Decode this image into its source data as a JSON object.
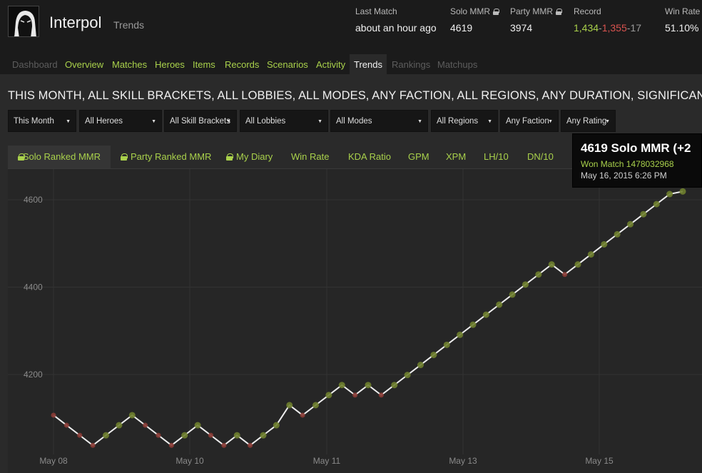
{
  "header": {
    "player_name": "Interpol",
    "page_subtitle": "Trends",
    "stats": {
      "last_match": {
        "label": "Last Match",
        "value": "about an hour ago"
      },
      "solo_mmr": {
        "label": "Solo MMR",
        "value": "4619"
      },
      "party_mmr": {
        "label": "Party MMR",
        "value": "3974"
      },
      "record": {
        "label": "Record",
        "wins": "1,434",
        "losses": "1,355",
        "abandons": "17",
        "separator": "-"
      },
      "win_rate": {
        "label": "Win Rate",
        "value": "51.10%"
      }
    }
  },
  "nav": [
    {
      "label": "Dashboard",
      "state": "disabled"
    },
    {
      "label": "Overview",
      "state": "enabled"
    },
    {
      "label": "Matches",
      "state": "enabled"
    },
    {
      "label": "Heroes",
      "state": "enabled"
    },
    {
      "label": "Items",
      "state": "enabled"
    },
    {
      "label": "Records",
      "state": "enabled"
    },
    {
      "label": "Scenarios",
      "state": "enabled"
    },
    {
      "label": "Activity",
      "state": "enabled"
    },
    {
      "label": "Trends",
      "state": "active"
    },
    {
      "label": "Rankings",
      "state": "disabled"
    },
    {
      "label": "Matchups",
      "state": "disabled"
    }
  ],
  "filter_title": "THIS MONTH, ALL SKILL BRACKETS, ALL LOBBIES, ALL MODES, ANY FACTION, ALL REGIONS, ANY DURATION, SIGNIFICANT",
  "filters": [
    "This Month",
    "All Heroes",
    "All Skill Brackets",
    "All Lobbies",
    "All Modes",
    "All Regions",
    "Any Faction",
    "Any Rating"
  ],
  "tabs": [
    {
      "label": "Solo Ranked MMR",
      "locked": true,
      "active": true
    },
    {
      "label": "Party Ranked MMR",
      "locked": true,
      "active": false
    },
    {
      "label": "My Diary",
      "locked": true,
      "active": false
    },
    {
      "label": "Win Rate",
      "locked": false,
      "active": false
    },
    {
      "label": "KDA Ratio",
      "locked": false,
      "active": false
    },
    {
      "label": "GPM",
      "locked": false,
      "active": false
    },
    {
      "label": "XPM",
      "locked": false,
      "active": false
    },
    {
      "label": "LH/10",
      "locked": false,
      "active": false
    },
    {
      "label": "DN/10",
      "locked": false,
      "active": false
    }
  ],
  "tooltip": {
    "title": "4619 Solo MMR (+2",
    "result": "Won Match 1478032968",
    "date": "May 16, 2015 6:26 PM"
  },
  "colors": {
    "win": "#a9d14b",
    "loss": "#d9534f",
    "line": "#eeeeee",
    "win_point": "#6f7f2f",
    "loss_point": "#8a3b35"
  },
  "chart_data": {
    "type": "line",
    "title": "",
    "xlabel": "",
    "ylabel": "",
    "ylim": [
      4030,
      4660
    ],
    "xlim": [
      "May 07 20:00",
      "May 16 23:00"
    ],
    "grid": true,
    "x_ticks": [
      "May 08",
      "May 10",
      "May 11",
      "May 13",
      "May 15"
    ],
    "y_ticks": [
      4200,
      4400,
      4600
    ],
    "series": [
      {
        "values": [
          4107,
          4084,
          4061,
          4038,
          4061,
          4084,
          4107,
          4084,
          4061,
          4038,
          4061,
          4084,
          4061,
          4038,
          4061,
          4038,
          4061,
          4084,
          4130,
          4107,
          4130,
          4153,
          4176,
          4153,
          4176,
          4153,
          4176,
          4199,
          4222,
          4245,
          4268,
          4291,
          4314,
          4337,
          4360,
          4383,
          4406,
          4429,
          4452,
          4429,
          4452,
          4475,
          4498,
          4521,
          4544,
          4567,
          4590,
          4613,
          4619
        ],
        "results": [
          "L",
          "L",
          "L",
          "L",
          "W",
          "W",
          "W",
          "L",
          "L",
          "L",
          "W",
          "W",
          "L",
          "L",
          "W",
          "L",
          "W",
          "W",
          "W",
          "L",
          "W",
          "W",
          "W",
          "L",
          "W",
          "L",
          "W",
          "W",
          "W",
          "W",
          "W",
          "W",
          "W",
          "W",
          "W",
          "W",
          "W",
          "W",
          "W",
          "L",
          "W",
          "W",
          "W",
          "W",
          "W",
          "W",
          "W",
          "W",
          "W"
        ]
      }
    ]
  }
}
